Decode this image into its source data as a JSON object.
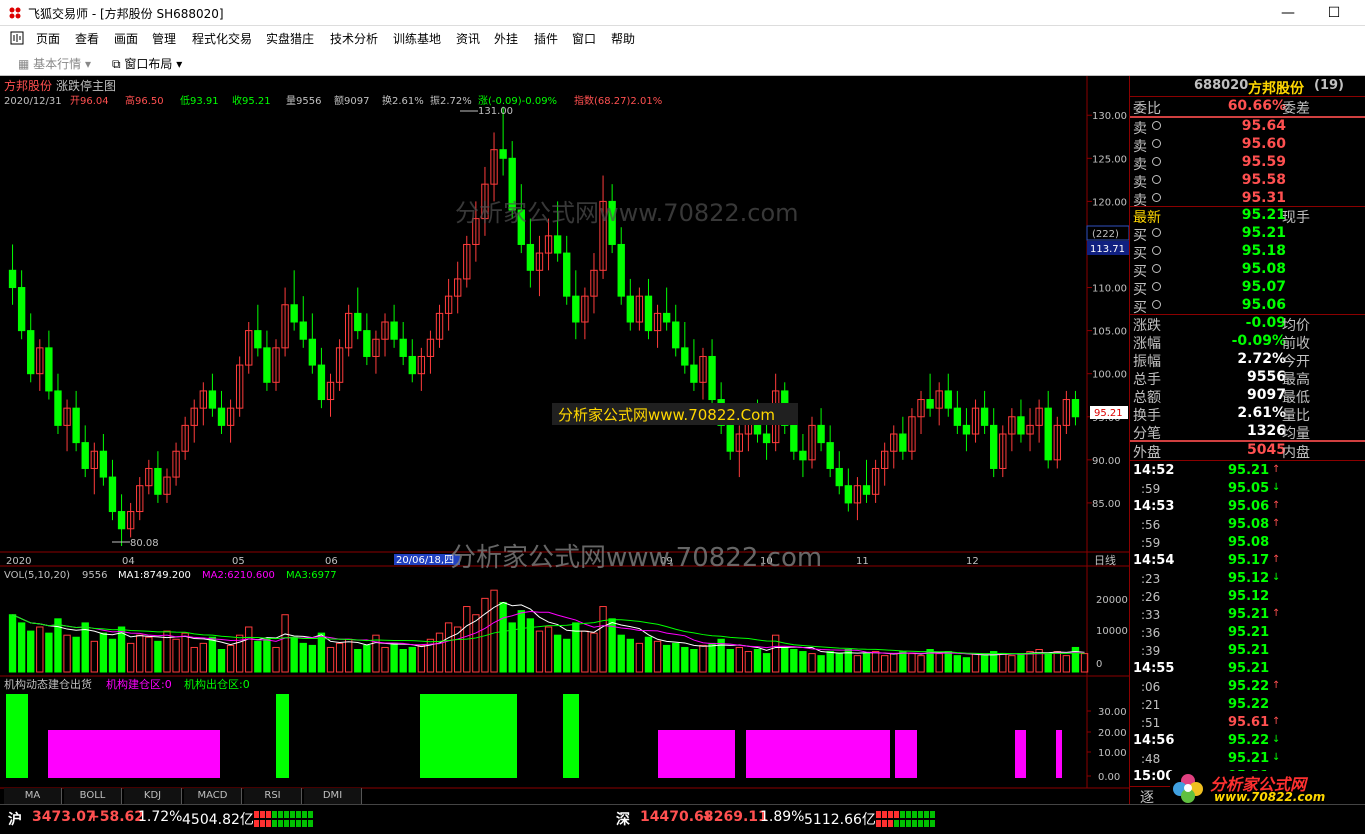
{
  "window": {
    "app_name": "飞狐交易师",
    "doc_title": "[方邦股份 SH688020]",
    "min_label": "—",
    "max_label": "☐",
    "close_label": "✕"
  },
  "menu": [
    "页面",
    "查看",
    "画面",
    "管理",
    "程式化交易",
    "实盘猎庄",
    "技术分析",
    "训练基地",
    "资讯",
    "外挂",
    "插件",
    "窗口",
    "帮助"
  ],
  "toolbar": {
    "basic": "基本行情",
    "layout": "窗口布局"
  },
  "chart": {
    "title": "方邦股份",
    "subtitle": "涨跌停主图",
    "date": "2020/12/31",
    "open_label": "开96.04",
    "high_label": "高96.50",
    "low_label": "低93.91",
    "close_label": "收95.21",
    "vol_label": "量9556",
    "amount_label": "额9097",
    "turnover_label": "换2.61%",
    "amplitude_label": "振2.72%",
    "change_label": "涨(-0.09)-0.09%",
    "index_label": "指数(68.27)2.01%",
    "max_mark": "131.00",
    "min_mark": "80.08",
    "cursor_count": "(222)",
    "cursor_price": "113.71",
    "last_price_tag": "95.21",
    "price_ticks": [
      "130.00",
      "125.00",
      "120.00",
      "115.00",
      "110.00",
      "105.00",
      "100.00",
      "95.00",
      "90.00",
      "85.00"
    ],
    "month_labels": [
      "2020",
      "04",
      "05",
      "06",
      "07",
      "08",
      "09",
      "10",
      "11",
      "12"
    ],
    "cursor_date": "20/06/18,四",
    "period": "日线",
    "watermark": "分析家公式网www.70822.com",
    "watermark2": "分析家公式网www.70822.Com"
  },
  "volume": {
    "header": "VOL(5,10,20)",
    "value": "9556",
    "ma1": "MA1:8749.200",
    "ma2": "MA2:6210.600",
    "ma3": "MA3:6977",
    "ticks": [
      "20000",
      "10000",
      "0"
    ]
  },
  "indicator": {
    "name": "机构动态建仓出货",
    "build": "机构建仓区:0",
    "exit": "机构出仓区:0",
    "ticks": [
      "30.00",
      "20.00",
      "10.00",
      "0.00"
    ]
  },
  "tabs": [
    "MA",
    "BOLL",
    "KDJ",
    "MACD",
    "RSI",
    "DMI"
  ],
  "quote": {
    "code": "688020",
    "name": "方邦股份",
    "num": "(19)",
    "weibi_label": "委比",
    "weibi_val": "60.66%",
    "weicha_label": "委差",
    "sells": [
      {
        "label": "卖",
        "price": "95.64"
      },
      {
        "label": "卖",
        "price": "95.60"
      },
      {
        "label": "卖",
        "price": "95.59"
      },
      {
        "label": "卖",
        "price": "95.58"
      },
      {
        "label": "卖",
        "price": "95.31"
      }
    ],
    "latest_label": "最新",
    "latest_val": "95.21",
    "xianshou_label": "现手",
    "buys": [
      {
        "label": "买",
        "price": "95.21"
      },
      {
        "label": "买",
        "price": "95.18"
      },
      {
        "label": "买",
        "price": "95.08"
      },
      {
        "label": "买",
        "price": "95.07"
      },
      {
        "label": "买",
        "price": "95.06"
      }
    ],
    "stats": [
      {
        "l": "涨跌",
        "v": "-0.09",
        "r": "均价",
        "c": "#00ff00"
      },
      {
        "l": "涨幅",
        "v": "-0.09%",
        "r": "前收",
        "c": "#00ff00"
      },
      {
        "l": "振幅",
        "v": "2.72%",
        "r": "今开",
        "c": "#ffffff"
      },
      {
        "l": "总手",
        "v": "9556",
        "r": "最高",
        "c": "#ffffff"
      },
      {
        "l": "总额",
        "v": "9097",
        "r": "最低",
        "c": "#ffffff"
      },
      {
        "l": "换手",
        "v": "2.61%",
        "r": "量比",
        "c": "#ffffff"
      },
      {
        "l": "分笔",
        "v": "1326",
        "r": "均量",
        "c": "#ffffff"
      }
    ],
    "waipan_label": "外盘",
    "waipan_val": "5045",
    "neipan_label": "内盘",
    "ticks": [
      {
        "t": "14:52",
        "p": "95.21",
        "a": "↑",
        "c": "#00ff00",
        "ac": "#ff5050",
        "big": true
      },
      {
        "t": ":59",
        "p": "95.05",
        "a": "↓",
        "c": "#00ff00",
        "ac": "#00ff00",
        "big": false
      },
      {
        "t": "14:53",
        "p": "95.06",
        "a": "↑",
        "c": "#00ff00",
        "ac": "#ff5050",
        "big": true
      },
      {
        "t": ":56",
        "p": "95.08",
        "a": "↑",
        "c": "#00ff00",
        "ac": "#ff5050",
        "big": false
      },
      {
        "t": ":59",
        "p": "95.08",
        "a": "",
        "c": "#00ff00",
        "ac": "#00ff00",
        "big": false
      },
      {
        "t": "14:54",
        "p": "95.17",
        "a": "↑",
        "c": "#00ff00",
        "ac": "#ff5050",
        "big": true
      },
      {
        "t": ":23",
        "p": "95.12",
        "a": "↓",
        "c": "#00ff00",
        "ac": "#00ff00",
        "big": false
      },
      {
        "t": ":26",
        "p": "95.12",
        "a": "",
        "c": "#00ff00",
        "ac": "#00ff00",
        "big": false
      },
      {
        "t": ":33",
        "p": "95.21",
        "a": "↑",
        "c": "#00ff00",
        "ac": "#ff5050",
        "big": false
      },
      {
        "t": ":36",
        "p": "95.21",
        "a": "",
        "c": "#00ff00",
        "ac": "#00ff00",
        "big": false
      },
      {
        "t": ":39",
        "p": "95.21",
        "a": "",
        "c": "#00ff00",
        "ac": "#00ff00",
        "big": false
      },
      {
        "t": "14:55",
        "p": "95.21",
        "a": "",
        "c": "#00ff00",
        "ac": "#00ff00",
        "big": true
      },
      {
        "t": ":06",
        "p": "95.22",
        "a": "↑",
        "c": "#00ff00",
        "ac": "#ff5050",
        "big": false
      },
      {
        "t": ":21",
        "p": "95.22",
        "a": "",
        "c": "#00ff00",
        "ac": "#00ff00",
        "big": false
      },
      {
        "t": ":51",
        "p": "95.61",
        "a": "↑",
        "c": "#ff5050",
        "ac": "#ff5050",
        "big": false
      },
      {
        "t": "14:56",
        "p": "95.22",
        "a": "↓",
        "c": "#00ff00",
        "ac": "#00ff00",
        "big": true
      },
      {
        "t": ":48",
        "p": "95.21",
        "a": "↓",
        "c": "#00ff00",
        "ac": "#00ff00",
        "big": false
      },
      {
        "t": "15:00",
        "p": "95.21",
        "a": "",
        "c": "#00ff00",
        "ac": "#00ff00",
        "big": true
      }
    ],
    "zhu_label": "逐"
  },
  "status": {
    "sh_label": "沪",
    "sh_index": "3473.07",
    "sh_change": "+58.62",
    "sh_pct": "1.72%",
    "sh_amount": "4504.82亿",
    "sz_label": "深",
    "sz_index": "14470.68",
    "sz_change": "+269.11",
    "sz_pct": "1.89%",
    "sz_amount": "5112.66亿",
    "brand": "分析家公式网",
    "brand_url": "www.70822.com"
  },
  "colors": {
    "up": "#ff3c3c",
    "down": "#00ff00",
    "axis": "#8b0000",
    "magenta": "#ff00ff"
  },
  "chart_data": {
    "type": "candlestick",
    "ylim": [
      80,
      132
    ],
    "candles": [
      [
        112,
        115,
        108,
        110
      ],
      [
        110,
        112,
        104,
        105
      ],
      [
        105,
        107,
        99,
        100
      ],
      [
        100,
        104,
        98,
        103
      ],
      [
        103,
        105,
        97,
        98
      ],
      [
        98,
        100,
        93,
        94
      ],
      [
        94,
        97,
        91,
        96
      ],
      [
        96,
        98,
        91,
        92
      ],
      [
        92,
        94,
        88,
        89
      ],
      [
        89,
        92,
        86,
        91
      ],
      [
        91,
        93,
        87,
        88
      ],
      [
        88,
        90,
        83,
        84
      ],
      [
        84,
        86,
        80,
        82
      ],
      [
        82,
        85,
        81,
        84
      ],
      [
        84,
        88,
        83,
        87
      ],
      [
        87,
        90,
        86,
        89
      ],
      [
        89,
        91,
        85,
        86
      ],
      [
        86,
        89,
        85,
        88
      ],
      [
        88,
        92,
        87,
        91
      ],
      [
        91,
        95,
        90,
        94
      ],
      [
        94,
        97,
        92,
        96
      ],
      [
        96,
        99,
        94,
        98
      ],
      [
        98,
        100,
        95,
        96
      ],
      [
        96,
        98,
        93,
        94
      ],
      [
        94,
        97,
        92,
        96
      ],
      [
        96,
        102,
        95,
        101
      ],
      [
        101,
        106,
        100,
        105
      ],
      [
        105,
        108,
        102,
        103
      ],
      [
        103,
        105,
        98,
        99
      ],
      [
        99,
        104,
        98,
        103
      ],
      [
        103,
        110,
        102,
        108
      ],
      [
        108,
        112,
        105,
        106
      ],
      [
        106,
        109,
        103,
        104
      ],
      [
        104,
        107,
        100,
        101
      ],
      [
        101,
        103,
        96,
        97
      ],
      [
        97,
        100,
        95,
        99
      ],
      [
        99,
        104,
        98,
        103
      ],
      [
        103,
        108,
        102,
        107
      ],
      [
        107,
        110,
        104,
        105
      ],
      [
        105,
        107,
        101,
        102
      ],
      [
        102,
        105,
        100,
        104
      ],
      [
        104,
        107,
        102,
        106
      ],
      [
        106,
        108,
        103,
        104
      ],
      [
        104,
        106,
        101,
        102
      ],
      [
        102,
        104,
        99,
        100
      ],
      [
        100,
        103,
        98,
        102
      ],
      [
        102,
        105,
        100,
        104
      ],
      [
        104,
        108,
        103,
        107
      ],
      [
        107,
        111,
        105,
        109
      ],
      [
        109,
        113,
        107,
        111
      ],
      [
        111,
        116,
        110,
        115
      ],
      [
        115,
        120,
        113,
        118
      ],
      [
        118,
        124,
        116,
        122
      ],
      [
        122,
        128,
        120,
        126
      ],
      [
        126,
        131,
        123,
        125
      ],
      [
        125,
        127,
        118,
        119
      ],
      [
        119,
        122,
        114,
        115
      ],
      [
        115,
        118,
        110,
        112
      ],
      [
        112,
        116,
        109,
        114
      ],
      [
        114,
        118,
        112,
        116
      ],
      [
        116,
        120,
        113,
        114
      ],
      [
        114,
        116,
        108,
        109
      ],
      [
        109,
        112,
        104,
        106
      ],
      [
        106,
        110,
        104,
        109
      ],
      [
        109,
        114,
        107,
        112
      ],
      [
        112,
        123,
        111,
        120
      ],
      [
        120,
        122,
        114,
        115
      ],
      [
        115,
        117,
        108,
        109
      ],
      [
        109,
        111,
        105,
        106
      ],
      [
        106,
        110,
        105,
        109
      ],
      [
        109,
        111,
        104,
        105
      ],
      [
        105,
        108,
        103,
        107
      ],
      [
        107,
        110,
        105,
        106
      ],
      [
        106,
        108,
        102,
        103
      ],
      [
        103,
        106,
        100,
        101
      ],
      [
        101,
        104,
        98,
        99
      ],
      [
        99,
        103,
        97,
        102
      ],
      [
        102,
        104,
        96,
        97
      ],
      [
        97,
        99,
        93,
        94
      ],
      [
        94,
        96,
        90,
        91
      ],
      [
        91,
        94,
        88,
        93
      ],
      [
        93,
        96,
        91,
        95
      ],
      [
        95,
        97,
        92,
        93
      ],
      [
        93,
        95,
        90,
        92
      ],
      [
        92,
        100,
        91,
        98
      ],
      [
        98,
        99,
        93,
        94
      ],
      [
        94,
        96,
        90,
        91
      ],
      [
        91,
        93,
        88,
        90
      ],
      [
        90,
        95,
        89,
        94
      ],
      [
        94,
        96,
        91,
        92
      ],
      [
        92,
        94,
        88,
        89
      ],
      [
        89,
        91,
        86,
        87
      ],
      [
        87,
        89,
        84,
        85
      ],
      [
        85,
        88,
        83,
        87
      ],
      [
        87,
        90,
        85,
        86
      ],
      [
        86,
        90,
        85,
        89
      ],
      [
        89,
        92,
        87,
        91
      ],
      [
        91,
        94,
        89,
        93
      ],
      [
        93,
        95,
        90,
        91
      ],
      [
        91,
        96,
        90,
        95
      ],
      [
        95,
        98,
        93,
        97
      ],
      [
        97,
        100,
        95,
        96
      ],
      [
        96,
        99,
        94,
        98
      ],
      [
        98,
        100,
        95,
        96
      ],
      [
        96,
        98,
        93,
        94
      ],
      [
        94,
        96,
        91,
        93
      ],
      [
        93,
        97,
        92,
        96
      ],
      [
        96,
        98,
        93,
        94
      ],
      [
        94,
        96,
        88,
        89
      ],
      [
        89,
        94,
        88,
        93
      ],
      [
        93,
        96,
        91,
        95
      ],
      [
        95,
        97,
        92,
        93
      ],
      [
        93,
        96,
        91,
        94
      ],
      [
        94,
        97,
        92,
        96
      ],
      [
        96,
        98,
        89,
        90
      ],
      [
        90,
        95,
        89,
        94
      ],
      [
        94,
        98,
        93,
        97
      ],
      [
        97,
        98,
        94,
        95
      ]
    ],
    "volume": [
      140,
      120,
      100,
      110,
      95,
      130,
      90,
      85,
      120,
      75,
      95,
      80,
      110,
      70,
      90,
      85,
      75,
      100,
      80,
      95,
      60,
      70,
      85,
      55,
      65,
      90,
      110,
      75,
      80,
      60,
      140,
      85,
      70,
      65,
      95,
      60,
      70,
      80,
      55,
      65,
      90,
      60,
      70,
      55,
      60,
      65,
      80,
      95,
      120,
      110,
      160,
      140,
      180,
      200,
      170,
      120,
      150,
      130,
      100,
      110,
      90,
      80,
      120,
      100,
      95,
      160,
      130,
      90,
      80,
      70,
      85,
      75,
      65,
      70,
      60,
      55,
      65,
      70,
      80,
      55,
      60,
      50,
      55,
      45,
      90,
      60,
      55,
      50,
      45,
      40,
      50,
      45,
      55,
      40,
      45,
      50,
      40,
      45,
      50,
      45,
      40,
      55,
      45,
      50,
      40,
      35,
      45,
      40,
      50,
      45,
      40,
      45,
      50,
      55,
      45,
      50,
      40,
      60,
      45
    ],
    "volume_ticks": [
      0,
      10000,
      20000
    ]
  }
}
